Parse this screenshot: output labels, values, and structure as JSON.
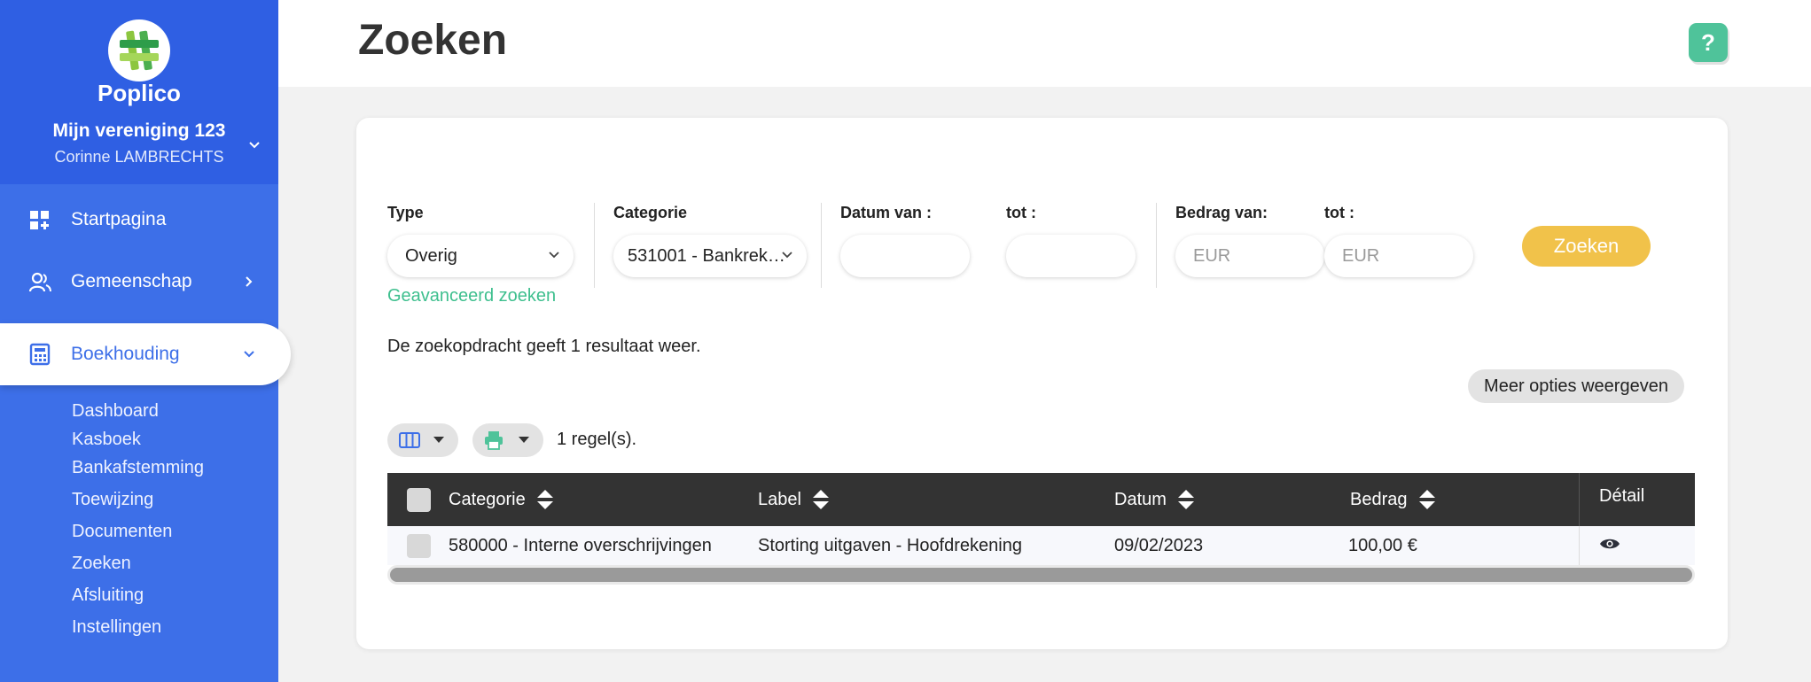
{
  "sidebar": {
    "brand": "Poplico",
    "organization": "Mijn vereniging 123",
    "user": "Corinne LAMBRECHTS",
    "nav": [
      {
        "label": "Startpagina",
        "icon": "dashboard-grid-icon"
      },
      {
        "label": "Gemeenschap",
        "icon": "users-icon"
      },
      {
        "label": "Boekhouding",
        "icon": "calculator-icon",
        "active": true
      }
    ],
    "subnav": [
      "Dashboard",
      "Kasboek",
      "Bankafstemming",
      "Toewijzing",
      "Documenten",
      "Zoeken",
      "Afsluiting",
      "Instellingen"
    ]
  },
  "header": {
    "title": "Zoeken",
    "help_label": "?"
  },
  "filters": {
    "type_label": "Type",
    "type_value": "Overig",
    "category_label": "Categorie",
    "category_value": "531001 - Bankrek…",
    "date_from_label": "Datum van :",
    "date_to_label": "tot :",
    "amount_from_label": "Bedrag van:",
    "amount_to_label": "tot :",
    "amount_placeholder": "EUR",
    "advanced_link": "Geavanceerd zoeken",
    "search_button": "Zoeken"
  },
  "results": {
    "summary": "De zoekopdracht geeft 1 resultaat weer.",
    "more_options": "Meer opties weergeven",
    "row_count": "1 regel(s)."
  },
  "table": {
    "columns": [
      "Categorie",
      "Label",
      "Datum",
      "Bedrag",
      "Détail"
    ],
    "rows": [
      {
        "categorie": "580000 - Interne overschrijvingen",
        "label": "Storting uitgaven - Hoofdrekening",
        "datum": "09/02/2023",
        "bedrag": "100,00 €"
      }
    ]
  },
  "colors": {
    "sidebar": "#3d6fe8",
    "sidebar_top": "#2f5fe3",
    "accent_green": "#3ebf8e",
    "search_button": "#f1c24a",
    "table_header": "#333333"
  }
}
